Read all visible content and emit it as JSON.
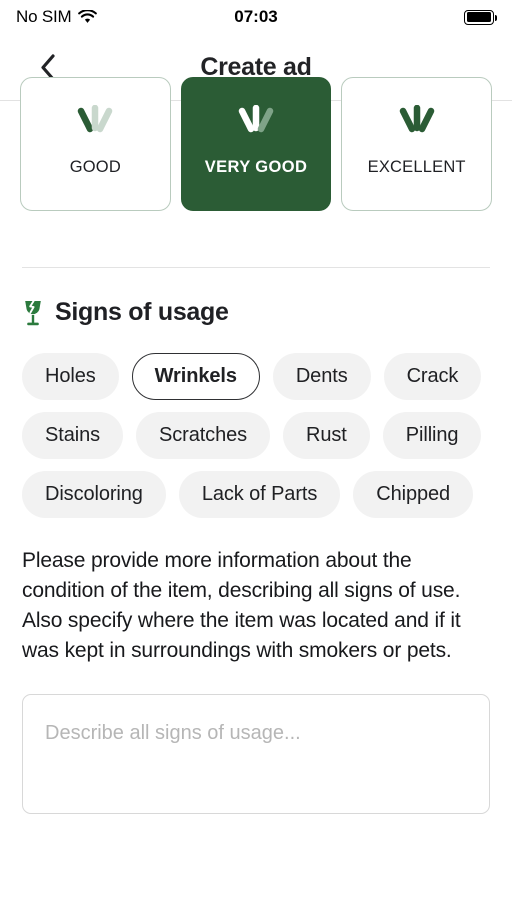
{
  "status_bar": {
    "carrier": "No SIM",
    "time": "07:03",
    "wifi_icon": "wifi-icon",
    "battery_icon": "battery-full-icon"
  },
  "header": {
    "back_icon": "chevron-left-icon",
    "title": "Create ad"
  },
  "condition": {
    "options": [
      {
        "label": "GOOD",
        "selected": false,
        "rays_filled": 1
      },
      {
        "label": "VERY GOOD",
        "selected": true,
        "rays_filled": 2
      },
      {
        "label": "EXCELLENT",
        "selected": false,
        "rays_filled": 3
      }
    ]
  },
  "signs_section": {
    "icon": "broken-glass-icon",
    "title": "Signs of usage",
    "chips": [
      {
        "label": "Holes",
        "selected": false
      },
      {
        "label": "Wrinkels",
        "selected": true
      },
      {
        "label": "Dents",
        "selected": false
      },
      {
        "label": "Crack",
        "selected": false
      },
      {
        "label": "Stains",
        "selected": false
      },
      {
        "label": "Scratches",
        "selected": false
      },
      {
        "label": "Rust",
        "selected": false
      },
      {
        "label": "Pilling",
        "selected": false
      },
      {
        "label": "Discoloring",
        "selected": false
      },
      {
        "label": "Lack of Parts",
        "selected": false
      },
      {
        "label": "Chipped",
        "selected": false
      }
    ],
    "help_text": "Please provide more information about the condition of the item, describing all signs of use. Also specify where the item was located and if it was kept in surroundings with smokers or pets.",
    "description_value": "",
    "description_placeholder": "Describe all signs of usage..."
  },
  "colors": {
    "accent_green": "#2b5c35",
    "ray_muted": "#c9d8cd",
    "ray_muted_on_green": "#7fa388",
    "chip_bg": "#f2f2f2",
    "text_dark": "#1f2024"
  }
}
